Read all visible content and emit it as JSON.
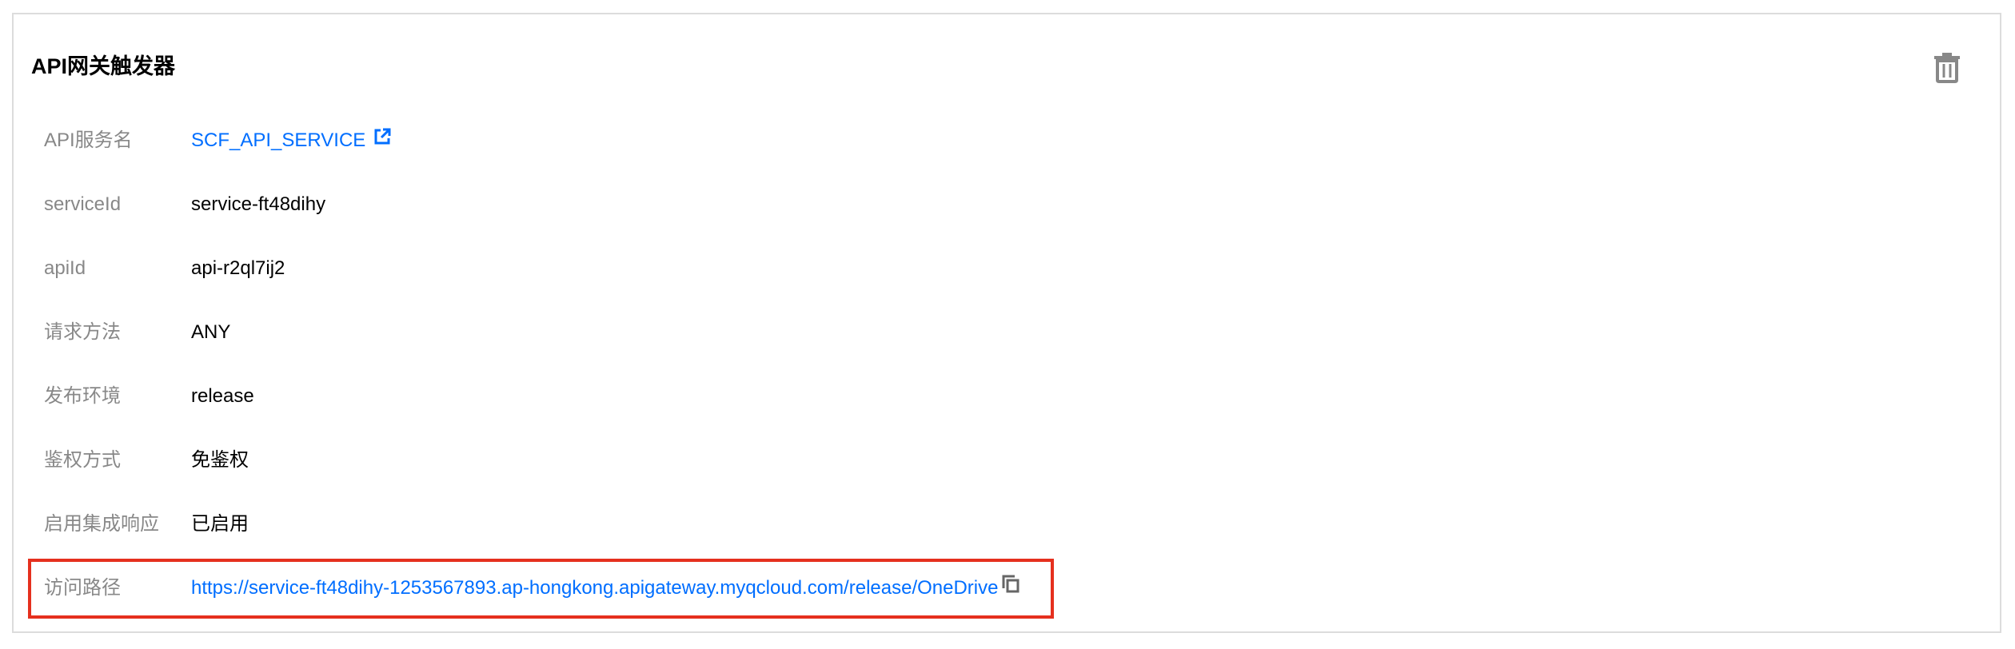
{
  "card": {
    "title": "API网关触发器",
    "delete_icon": "trash-icon"
  },
  "fields": [
    {
      "label": "API服务名",
      "value": "SCF_API_SERVICE",
      "is_link": true,
      "icon": "external-link-icon"
    },
    {
      "label": "serviceId",
      "value": "service-ft48dihy"
    },
    {
      "label": "apiId",
      "value": "api-r2ql7ij2"
    },
    {
      "label": "请求方法",
      "value": "ANY"
    },
    {
      "label": "发布环境",
      "value": "release"
    },
    {
      "label": "鉴权方式",
      "value": "免鉴权"
    },
    {
      "label": "启用集成响应",
      "value": "已启用"
    },
    {
      "label": "访问路径",
      "value": "https://service-ft48dihy-1253567893.ap-hongkong.apigateway.myqcloud.com/release/OneDrive",
      "is_link": true,
      "icon": "copy-icon"
    }
  ],
  "colors": {
    "link": "#006eff",
    "label": "#888888",
    "highlight": "#e5301e",
    "border": "#dcdcdc"
  }
}
